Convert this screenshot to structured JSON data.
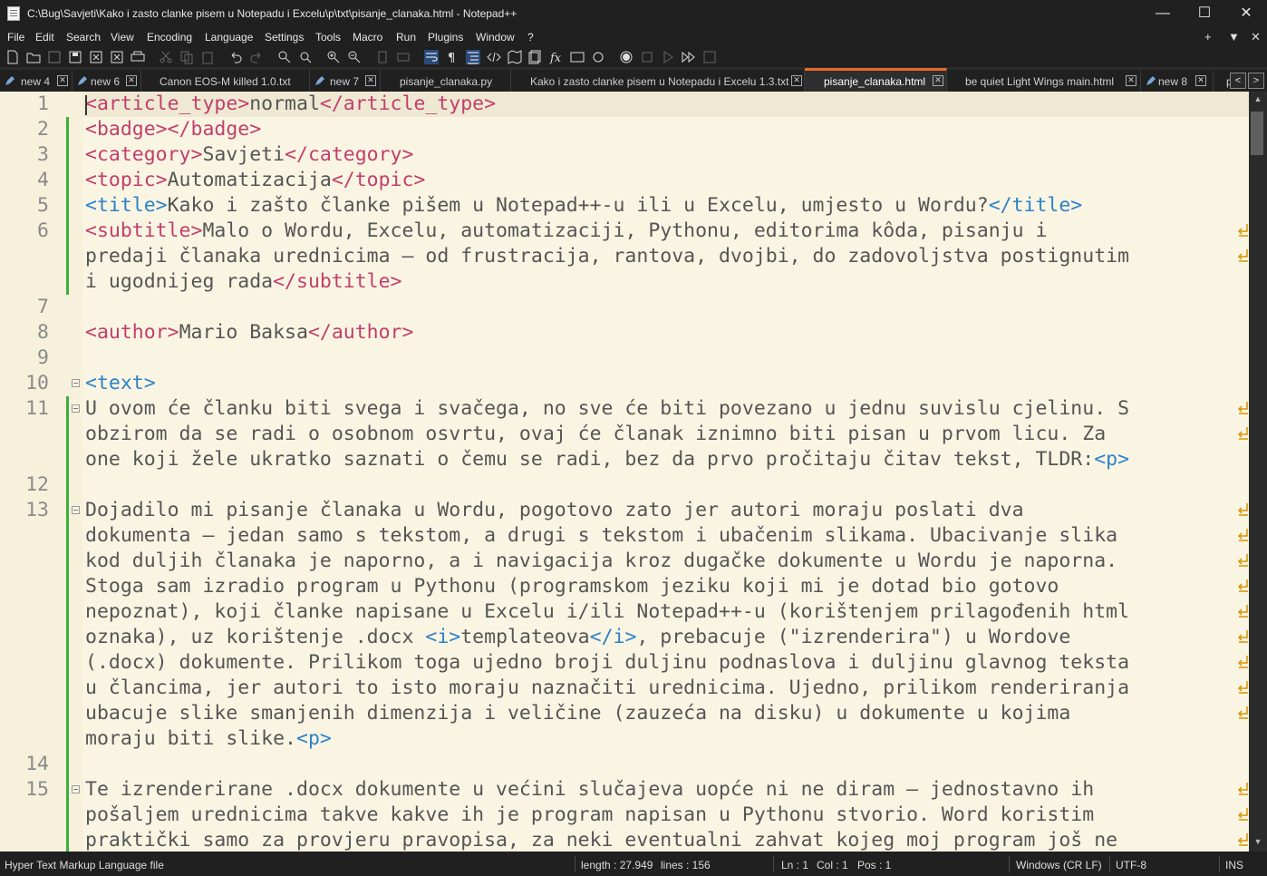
{
  "window": {
    "title": "C:\\Bug\\Savjeti\\Kako i zasto clanke pisem u Notepadu i Excelu\\p\\txt\\pisanje_clanaka.html - Notepad++",
    "minimize": "—",
    "maximize": "☐",
    "close": "✕"
  },
  "menu": {
    "items": [
      "File",
      "Edit",
      "Search",
      "View",
      "Encoding",
      "Language",
      "Settings",
      "Tools",
      "Macro",
      "Run",
      "Plugins",
      "Window",
      "?"
    ],
    "right": [
      "+",
      "▼",
      "✕"
    ]
  },
  "tabs": [
    {
      "label": "new 4",
      "pen": true
    },
    {
      "label": "new 6",
      "pen": true
    },
    {
      "label": "Canon EOS-M killed 1.0.txt",
      "pen": false
    },
    {
      "label": "new 7",
      "pen": true
    },
    {
      "label": "pisanje_clanaka.py",
      "pen": false
    },
    {
      "label": "Kako i zasto clanke pisem u Notepadu i Excelu 1.3.txt",
      "pen": false
    },
    {
      "label": "pisanje_clanaka.html",
      "pen": false,
      "active": true
    },
    {
      "label": "be quiet Light Wings main.html",
      "pen": false
    },
    {
      "label": "new 8",
      "pen": true
    },
    {
      "label": "p",
      "pen": false
    }
  ],
  "tab_arrows": [
    "<",
    ">"
  ],
  "editor": {
    "lines": [
      {
        "n": "1",
        "segs": [
          [
            "t",
            "<article_type>"
          ],
          [
            "x",
            "normal"
          ],
          [
            "t",
            "</article_type>"
          ]
        ]
      },
      {
        "n": "2",
        "segs": [
          [
            "t",
            "<badge></badge>"
          ]
        ]
      },
      {
        "n": "3",
        "segs": [
          [
            "t",
            "<category>"
          ],
          [
            "x",
            "Savjeti"
          ],
          [
            "t",
            "</category>"
          ]
        ]
      },
      {
        "n": "4",
        "segs": [
          [
            "t",
            "<topic>"
          ],
          [
            "x",
            "Automatizacija"
          ],
          [
            "t",
            "</topic>"
          ]
        ]
      },
      {
        "n": "5",
        "segs": [
          [
            "b",
            "<title>"
          ],
          [
            "x",
            "Kako i zašto članke pišem u Notepad++-u ili u Excelu, umjesto u Wordu?"
          ],
          [
            "b",
            "</title>"
          ]
        ]
      },
      {
        "n": "6",
        "segs": [
          [
            "t",
            "<subtitle>"
          ],
          [
            "x",
            "Malo o Wordu, Excelu, automatizaciji, Pythonu, editorima kôda, pisanju i"
          ]
        ],
        "wrap": true
      },
      {
        "n": "",
        "segs": [
          [
            "x",
            "predaji članaka urednicima – od frustracija, rantova, dvojbi, do zadovoljstva postignutim"
          ]
        ],
        "wrap": true
      },
      {
        "n": "",
        "segs": [
          [
            "x",
            "i ugodnijeg rada"
          ],
          [
            "t",
            "</subtitle>"
          ]
        ]
      },
      {
        "n": "7",
        "segs": []
      },
      {
        "n": "8",
        "segs": [
          [
            "t",
            "<author>"
          ],
          [
            "x",
            "Mario Baksa"
          ],
          [
            "t",
            "</author>"
          ]
        ]
      },
      {
        "n": "9",
        "segs": []
      },
      {
        "n": "10",
        "segs": [
          [
            "b",
            "<text>"
          ]
        ]
      },
      {
        "n": "11",
        "segs": [
          [
            "x",
            "U ovom će članku biti svega i svačega, no sve će biti povezano u jednu suvislu cjelinu. S"
          ]
        ],
        "wrap": true
      },
      {
        "n": "",
        "segs": [
          [
            "x",
            "obzirom da se radi o osobnom osvrtu, ovaj će članak iznimno biti pisan u prvom licu. Za"
          ]
        ],
        "wrap": true
      },
      {
        "n": "",
        "segs": [
          [
            "x",
            "one koji žele ukratko saznati o čemu se radi, bez da prvo pročitaju čitav tekst, TLDR:"
          ],
          [
            "b",
            "<p>"
          ]
        ]
      },
      {
        "n": "12",
        "segs": []
      },
      {
        "n": "13",
        "segs": [
          [
            "x",
            "Dojadilo mi pisanje članaka u Wordu, pogotovo zato jer autori moraju poslati dva"
          ]
        ],
        "wrap": true
      },
      {
        "n": "",
        "segs": [
          [
            "x",
            "dokumenta – jedan samo s tekstom, a drugi s tekstom i ubačenim slikama. Ubacivanje slika"
          ]
        ],
        "wrap": true
      },
      {
        "n": "",
        "segs": [
          [
            "x",
            "kod duljih članaka je naporno, a i navigacija kroz dugačke dokumente u Wordu je naporna."
          ]
        ],
        "wrap": true
      },
      {
        "n": "",
        "segs": [
          [
            "x",
            "Stoga sam izradio program u Pythonu (programskom jeziku koji mi je dotad bio gotovo"
          ]
        ],
        "wrap": true
      },
      {
        "n": "",
        "segs": [
          [
            "x",
            "nepoznat), koji članke napisane u Excelu i/ili Notepad++-u (korištenjem prilagođenih html"
          ]
        ],
        "wrap": true
      },
      {
        "n": "",
        "segs": [
          [
            "x",
            "oznaka), uz korištenje .docx "
          ],
          [
            "b",
            "<i>"
          ],
          [
            "x",
            "templateova"
          ],
          [
            "b",
            "</i>"
          ],
          [
            "x",
            ", prebacuje (\"izrenderira\") u Wordove"
          ]
        ],
        "wrap": true
      },
      {
        "n": "",
        "segs": [
          [
            "x",
            "(.docx) dokumente. Prilikom toga ujedno broji duljinu podnaslova i duljinu glavnog teksta"
          ]
        ],
        "wrap": true
      },
      {
        "n": "",
        "segs": [
          [
            "x",
            "u člancima, jer autori to isto moraju naznačiti urednicima. Ujedno, prilikom renderiranja"
          ]
        ],
        "wrap": true
      },
      {
        "n": "",
        "segs": [
          [
            "x",
            "ubacuje slike smanjenih dimenzija i veličine (zauzeća na disku) u dokumente u kojima"
          ]
        ],
        "wrap": true
      },
      {
        "n": "",
        "segs": [
          [
            "x",
            "moraju biti slike."
          ],
          [
            "b",
            "<p>"
          ]
        ]
      },
      {
        "n": "14",
        "segs": []
      },
      {
        "n": "15",
        "segs": [
          [
            "x",
            "Te izrenderirane .docx dokumente u većini slučajeva uopće ni ne diram – jednostavno ih"
          ]
        ],
        "wrap": true
      },
      {
        "n": "",
        "segs": [
          [
            "x",
            "pošaljem urednicima takve kakve ih je program napisan u Pythonu stvorio. Word koristim"
          ]
        ],
        "wrap": true
      },
      {
        "n": "",
        "segs": [
          [
            "x",
            "praktički samo za provjeru pravopisa, za neki eventualni zahvat kojeg moj program još ne"
          ]
        ],
        "wrap": true
      }
    ]
  },
  "status": {
    "file_type": "Hyper Text Markup Language file",
    "length": "length : 27.949",
    "lines": "lines : 156",
    "ln": "Ln : 1",
    "col": "Col : 1",
    "pos": "Pos : 1",
    "eol": "Windows (CR LF)",
    "encoding": "UTF-8",
    "mode": "INS"
  },
  "colors": {
    "tag": "#c23e6b",
    "tag_blue": "#2c82c9",
    "tab_active_accent": "#e66c2c",
    "change_bar": "#3cae3c"
  }
}
